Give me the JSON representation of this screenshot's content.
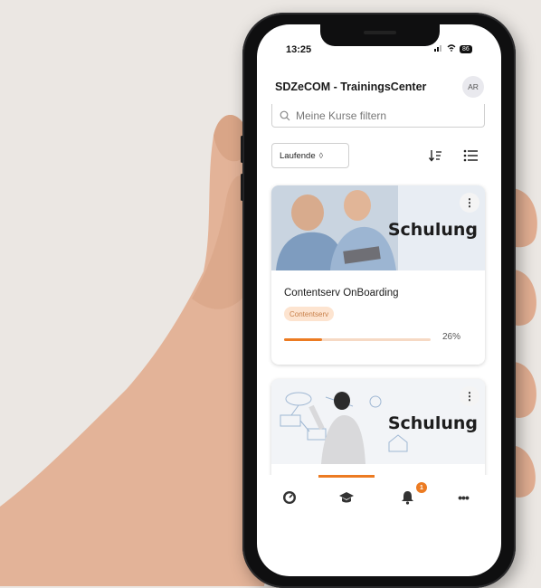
{
  "status_bar": {
    "time": "13:25",
    "battery": "86"
  },
  "header": {
    "title": "SDZeCOM - TrainingsCenter",
    "avatar_initials": "AR"
  },
  "search": {
    "placeholder": "Meine Kurse filtern"
  },
  "filter": {
    "selected": "Laufende"
  },
  "courses": [
    {
      "image_label": "Schulung",
      "title": "Contentserv OnBoarding",
      "tag": "Contentserv",
      "progress_percent": 26,
      "progress_text": "26%"
    },
    {
      "image_label": "Schulung"
    }
  ],
  "tabbar": {
    "items": [
      {
        "icon": "dashboard-icon"
      },
      {
        "icon": "graduation-cap-icon",
        "active": true
      },
      {
        "icon": "bell-icon",
        "badge": "1"
      },
      {
        "icon": "more-icon"
      }
    ]
  },
  "colors": {
    "accent": "#ec7b22",
    "tag_bg": "#fde4d0",
    "tag_text": "#c8804a"
  }
}
